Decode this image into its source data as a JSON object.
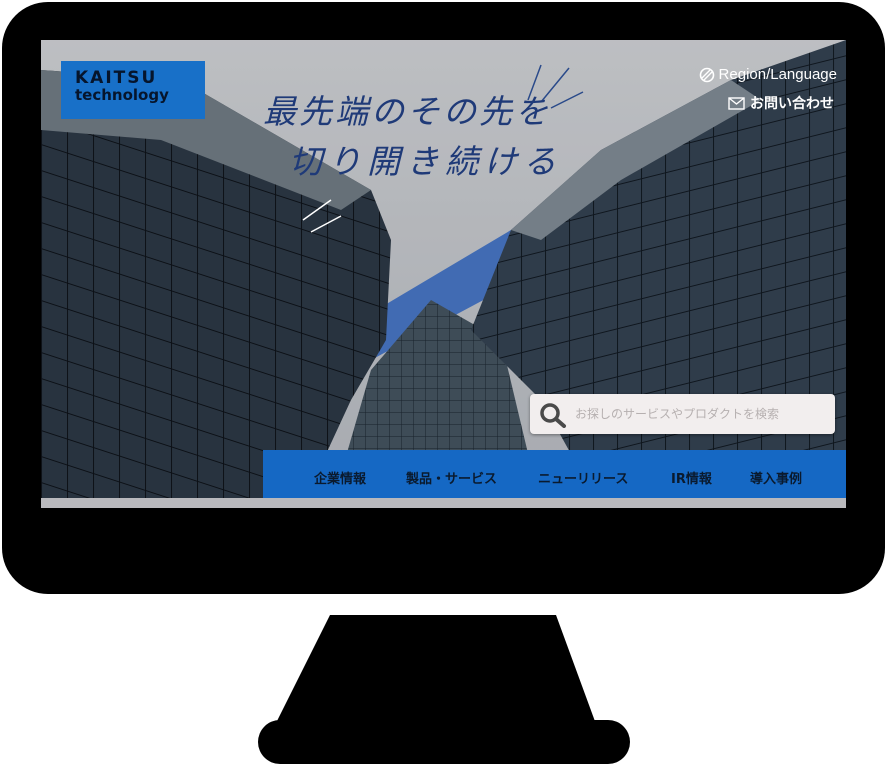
{
  "logo": {
    "line1": "KAITSU",
    "line2": "technology"
  },
  "headline": {
    "line1": "最先端のその先を",
    "line2": "切り開き続ける"
  },
  "top_links": {
    "region": "Region/Language",
    "contact": "お問い合わせ"
  },
  "search": {
    "placeholder": "お探しのサービスやプロダクトを検索"
  },
  "nav": {
    "items": [
      "企業情報",
      "製品・サービス",
      "ニューリリース",
      "IR情報",
      "導入事例"
    ]
  },
  "colors": {
    "brand_blue": "#1568c4",
    "logo_blue": "#1870c8",
    "headline": "#1f3a78",
    "bezel": "#000000"
  },
  "icons": {
    "region": "globe-icon",
    "contact": "mail-icon",
    "search": "search-icon"
  }
}
